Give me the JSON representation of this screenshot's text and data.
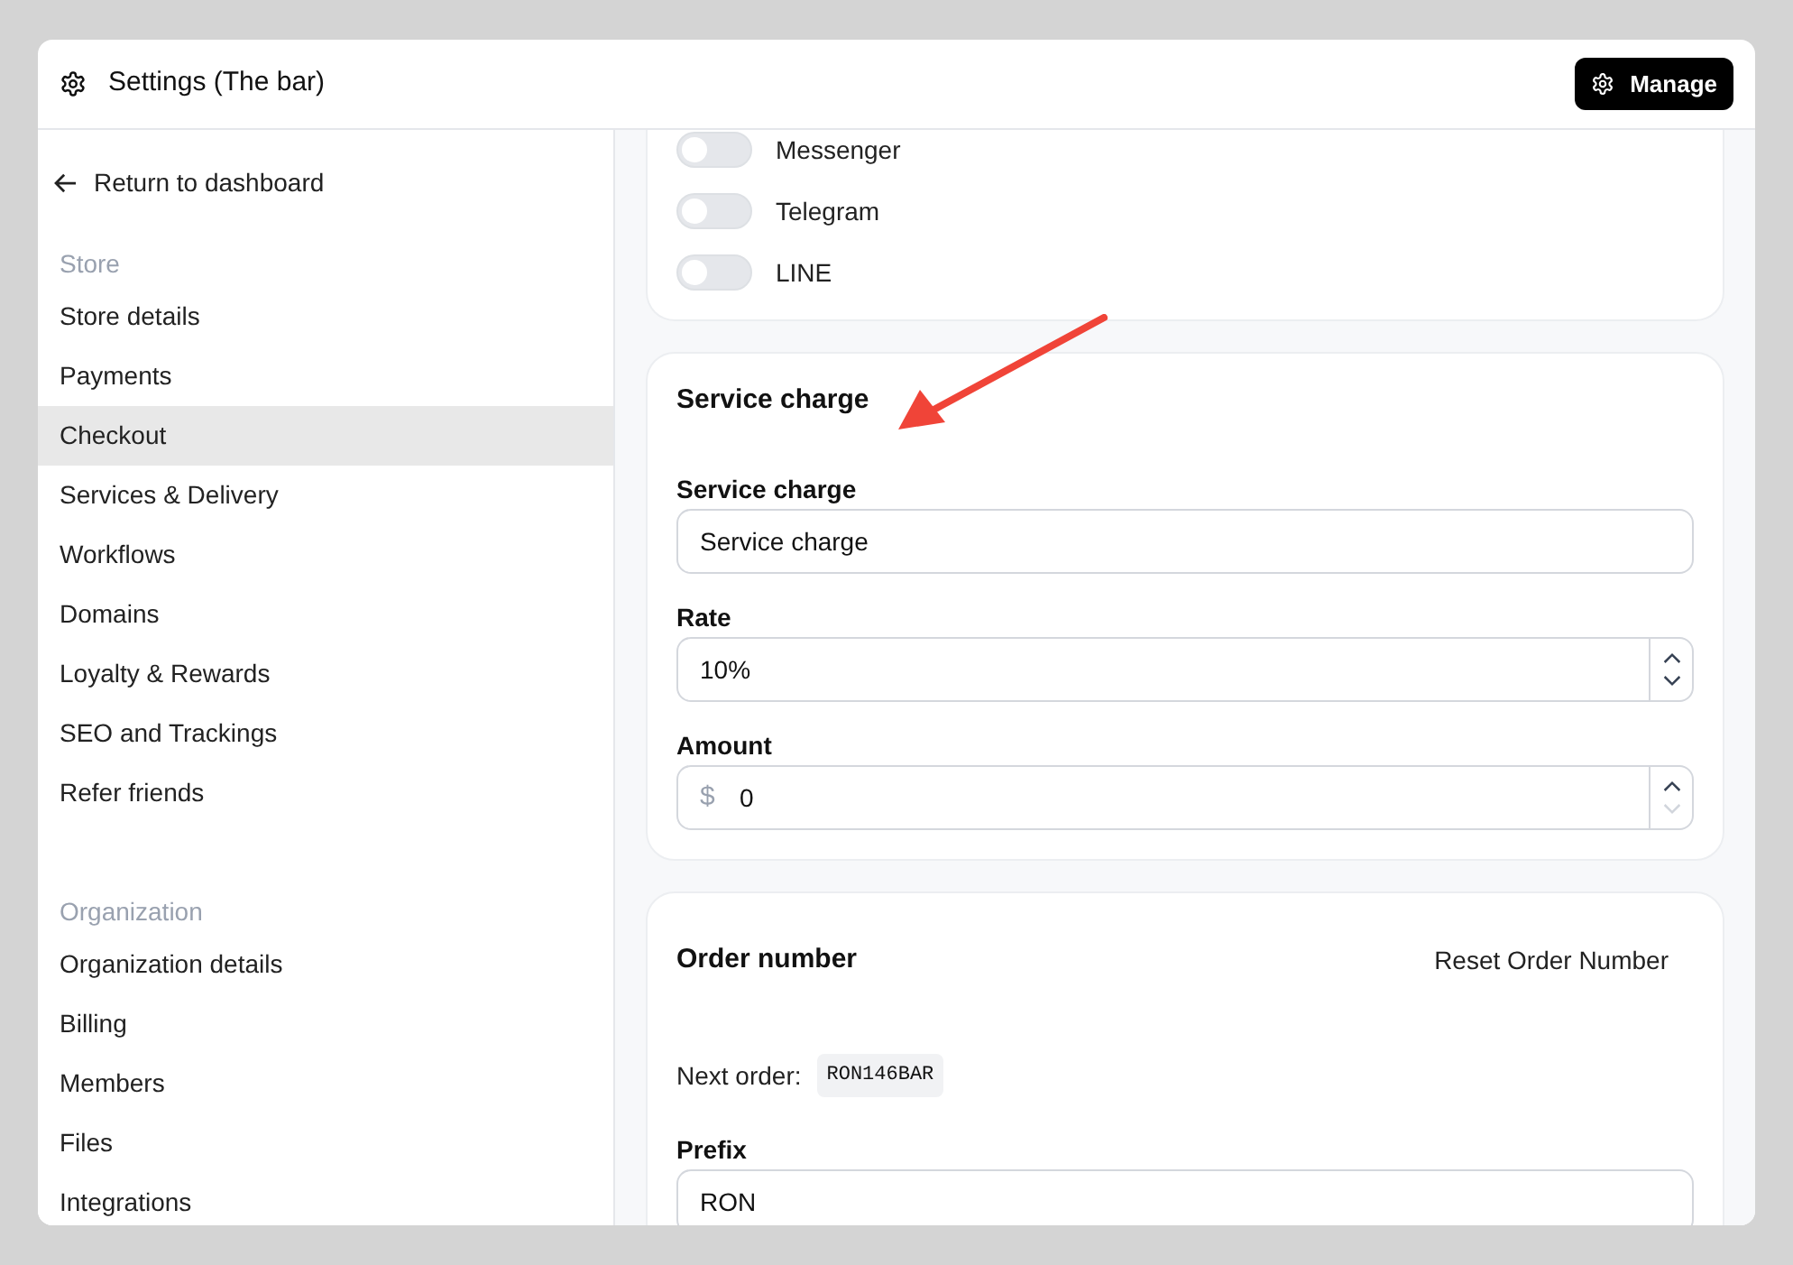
{
  "window": {
    "title": "Settings (The bar)",
    "manage_button": "Manage"
  },
  "sidebar": {
    "back_link": "Return to dashboard",
    "sections": [
      {
        "heading": "Store",
        "items": [
          {
            "label": "Store details",
            "selected": false
          },
          {
            "label": "Payments",
            "selected": false
          },
          {
            "label": "Checkout",
            "selected": true
          },
          {
            "label": "Services & Delivery",
            "selected": false
          },
          {
            "label": "Workflows",
            "selected": false
          },
          {
            "label": "Domains",
            "selected": false
          },
          {
            "label": "Loyalty & Rewards",
            "selected": false
          },
          {
            "label": "SEO and Trackings",
            "selected": false
          },
          {
            "label": "Refer friends",
            "selected": false
          }
        ]
      },
      {
        "heading": "Organization",
        "items": [
          {
            "label": "Organization details",
            "selected": false
          },
          {
            "label": "Billing",
            "selected": false
          },
          {
            "label": "Members",
            "selected": false
          },
          {
            "label": "Files",
            "selected": false
          },
          {
            "label": "Integrations",
            "selected": false
          }
        ]
      }
    ]
  },
  "channels": [
    {
      "name": "Messenger",
      "on": false
    },
    {
      "name": "Telegram",
      "on": false
    },
    {
      "name": "LINE",
      "on": false
    }
  ],
  "service_charge": {
    "title": "Service charge",
    "fields": [
      {
        "kind": "text",
        "label": "Service charge",
        "value": "Service charge"
      },
      {
        "kind": "number",
        "label": "Rate",
        "value": "10%",
        "up_disabled": false,
        "down_disabled": false
      },
      {
        "kind": "number",
        "label": "Amount",
        "prefix": "$",
        "value": "0",
        "up_disabled": false,
        "down_disabled": true
      }
    ]
  },
  "order_number": {
    "title": "Order number",
    "reset_button": "Reset Order Number",
    "next_order_label": "Next order:",
    "next_order": "RON146BAR",
    "fields": [
      {
        "kind": "text",
        "label": "Prefix",
        "value": "RON"
      }
    ]
  }
}
